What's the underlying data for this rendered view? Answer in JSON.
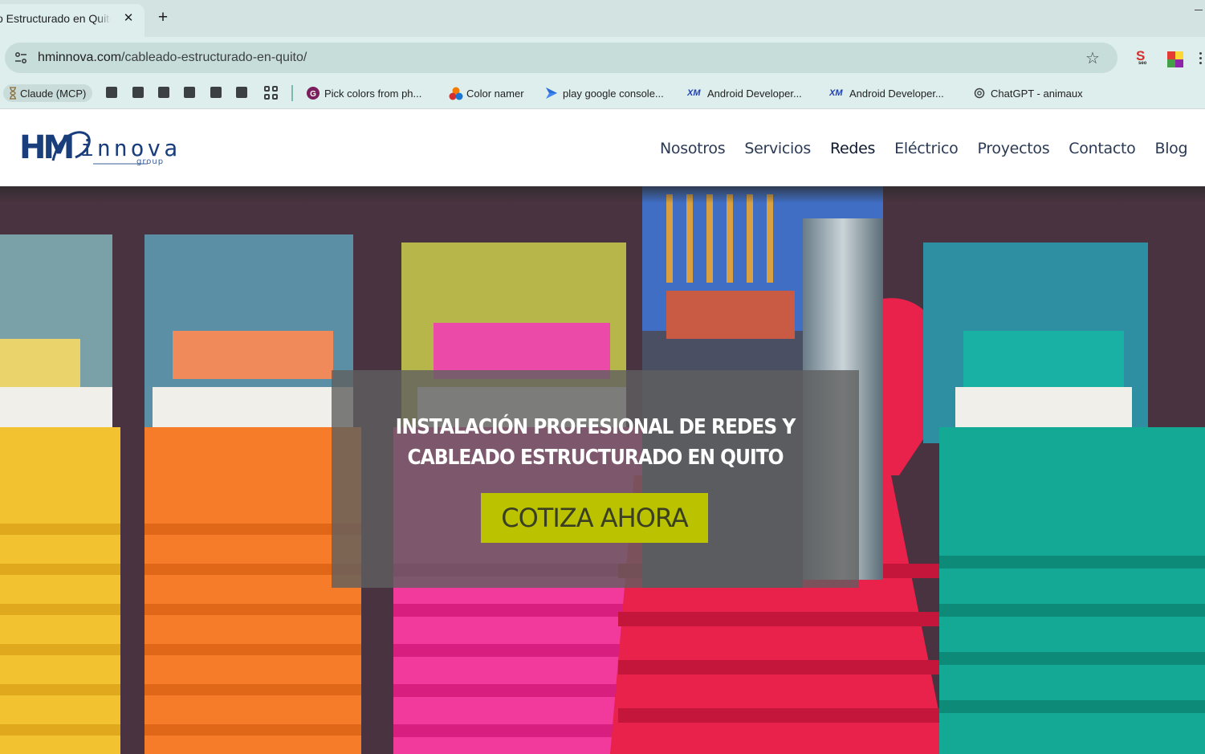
{
  "browser": {
    "tab_title": "o Estructurado en Quito",
    "tab_close": "✕",
    "new_tab": "+",
    "url_host": "hminnova.com",
    "url_path": "/cableado-estructurado-en-quito/",
    "star": "☆",
    "extensions": [
      {
        "icon": "seo-extension-icon",
        "text": "S",
        "sub": "seo"
      },
      {
        "icon": "color-grid-extension-icon"
      }
    ]
  },
  "bookmarks": {
    "claude": "Claude (MCP)",
    "pick_colors": "Pick colors from ph...",
    "color_namer": "Color namer",
    "play_console": "play google console...",
    "android_dev_1": "Android Developer...",
    "android_dev_2": "Android Developer...",
    "chatgpt": "ChatGPT - animaux"
  },
  "site": {
    "logo": {
      "mark": "HM",
      "name": "innova",
      "tagline": "group"
    },
    "nav": [
      "Nosotros",
      "Servicios",
      "Redes",
      "Eléctrico",
      "Proyectos",
      "Contacto",
      "Blog"
    ],
    "hero": {
      "title_line1": "Instalación profesional de redes y",
      "title_line2": "cableado estructurado en Quito",
      "cta_label": "COTIZA AHORA"
    }
  },
  "colors": {
    "brand_navy": "#1a3d7c",
    "cta_green": "#bbc300",
    "chrome_bg": "#ddeeed"
  }
}
